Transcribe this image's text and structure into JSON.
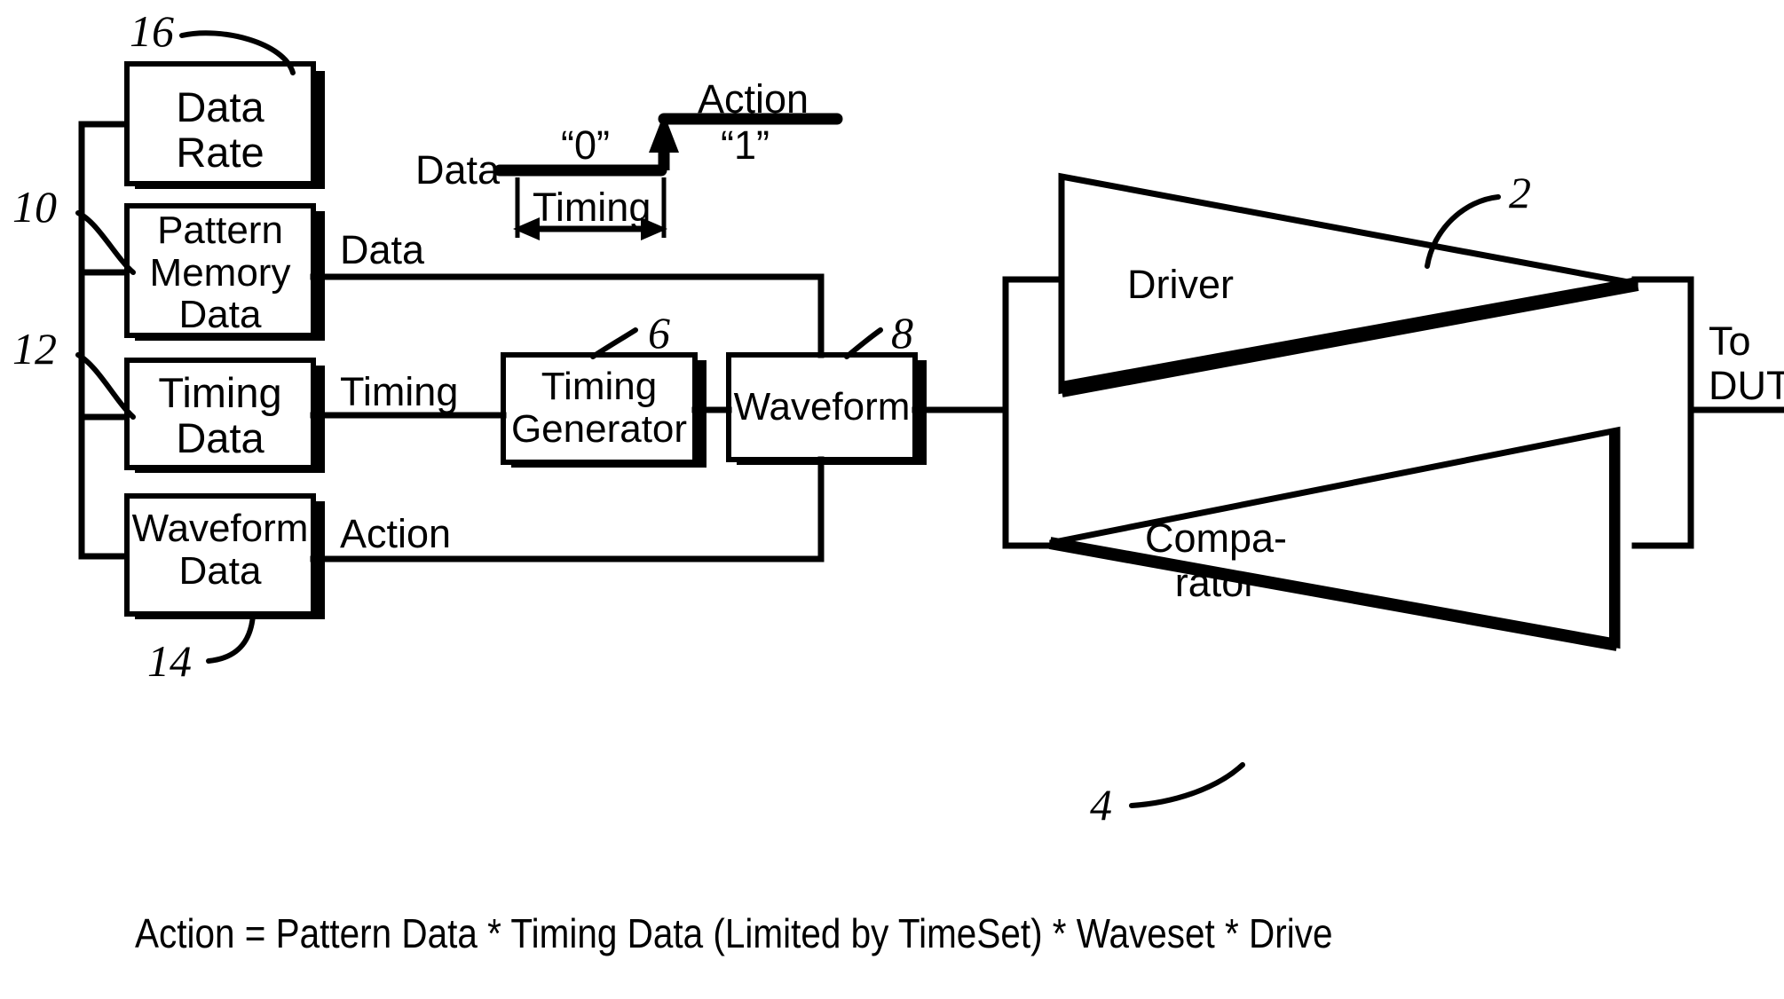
{
  "figure": {
    "equation": "Action = Pattern Data * Timing Data (Limited by TimeSet) * Waveset * Drive"
  },
  "blocks": [
    {
      "id": "data-rate",
      "label": "Data\nRate",
      "line1": "Data",
      "line2": "Rate",
      "line3": "",
      "ref": "16"
    },
    {
      "id": "pattern-memory",
      "label": "Pattern Memory Data",
      "line1": "Pattern",
      "line2": "Memory",
      "line3": "Data",
      "ref": "10"
    },
    {
      "id": "timing-data",
      "label": "Timing Data",
      "line1": "Timing",
      "line2": "Data",
      "line3": "",
      "ref": "12"
    },
    {
      "id": "waveform-data",
      "label": "Waveform Data",
      "line1": "Waveform",
      "line2": "Data",
      "line3": "",
      "ref": "14"
    },
    {
      "id": "timing-generator",
      "label": "Timing Generator",
      "line1": "Timing",
      "line2": "Generator",
      "line3": "",
      "ref": "6"
    },
    {
      "id": "waveform",
      "label": "Waveform",
      "line1": "Waveform",
      "line2": "",
      "line3": "",
      "ref": "8"
    }
  ],
  "amplifiers": [
    {
      "id": "driver",
      "line1": "Driver",
      "line2": "",
      "ref": "2"
    },
    {
      "id": "comparator",
      "line1": "Compa-",
      "line2": "rator",
      "ref": "4"
    }
  ],
  "wire_labels": {
    "data": "Data",
    "timing": "Timing",
    "action": "Action"
  },
  "output": {
    "line1": "To",
    "line2": "DUT"
  },
  "waveform_inset": {
    "signal_name": "Data",
    "low_level": "“0”",
    "high_level": "“1”",
    "edge_label": "Action",
    "span_label": "Timing"
  },
  "refs": {
    "r2": "2",
    "r4": "4",
    "r6": "6",
    "r8": "8",
    "r10": "10",
    "r12": "12",
    "r14": "14",
    "r16": "16"
  },
  "colors": {
    "ink": "#000000",
    "paper": "#ffffff"
  }
}
